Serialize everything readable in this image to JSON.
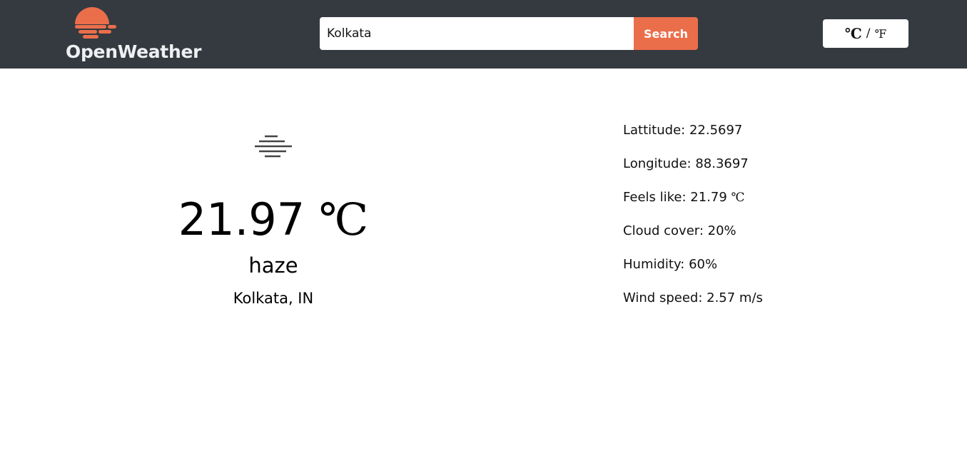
{
  "header": {
    "logo_text": "OpenWeather",
    "search": {
      "value": "Kolkata",
      "button_label": "Search"
    },
    "unit_toggle": {
      "celsius": "℃",
      "separator": "/",
      "fahrenheit": "℉"
    }
  },
  "weather": {
    "icon": "haze-icon",
    "temperature": "21.97",
    "temperature_unit": "℃",
    "description": "haze",
    "location": "Kolkata, IN"
  },
  "details": {
    "latitude": {
      "label": "Lattitude: ",
      "value": "22.5697"
    },
    "longitude": {
      "label": "Longitude: ",
      "value": "88.3697"
    },
    "feels_like": {
      "label": "Feels like: ",
      "value": "21.79",
      "unit": "℃"
    },
    "cloud_cover": {
      "label": "Cloud cover: ",
      "value": "20%"
    },
    "humidity": {
      "label": "Humidity: ",
      "value": "60%"
    },
    "wind_speed": {
      "label": "Wind speed: ",
      "value": "2.57 m/s"
    }
  },
  "colors": {
    "header_bg": "#343a40",
    "accent": "#eb6e4b",
    "background": "#ffffff"
  }
}
